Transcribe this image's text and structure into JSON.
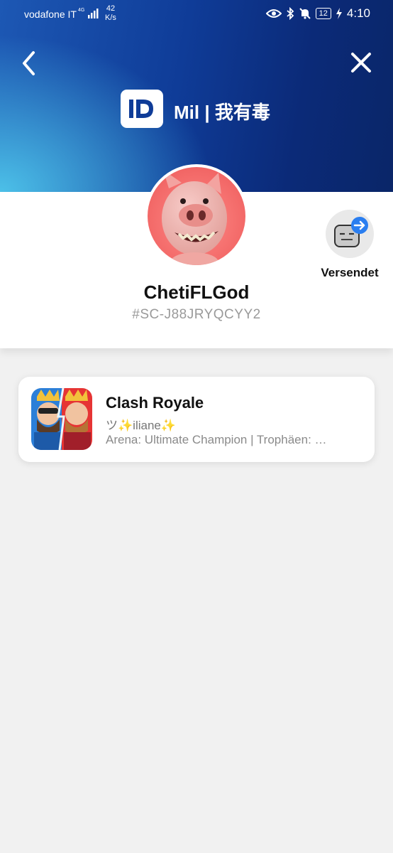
{
  "status_bar": {
    "carrier": "vodafone IT",
    "network": "4G",
    "speed_value": "42",
    "speed_unit": "K/s",
    "battery": "12",
    "time": "4:10"
  },
  "header": {
    "logo_text": "ID",
    "title": "Mil | 我有毒"
  },
  "profile": {
    "username": "ChetiFLGod",
    "tag": "#SC-J88JRYQCYY2",
    "send_label": "Versendet"
  },
  "games": [
    {
      "title": "Clash Royale",
      "player": "ツ✨iliane✨",
      "stats": "Arena: Ultimate Champion | Trophäen: …"
    }
  ],
  "colors": {
    "header_dark": "#0a2668",
    "header_light": "#4cc0e8",
    "accent_blue": "#2a7ef0",
    "page_bg": "#f1f1f1"
  }
}
